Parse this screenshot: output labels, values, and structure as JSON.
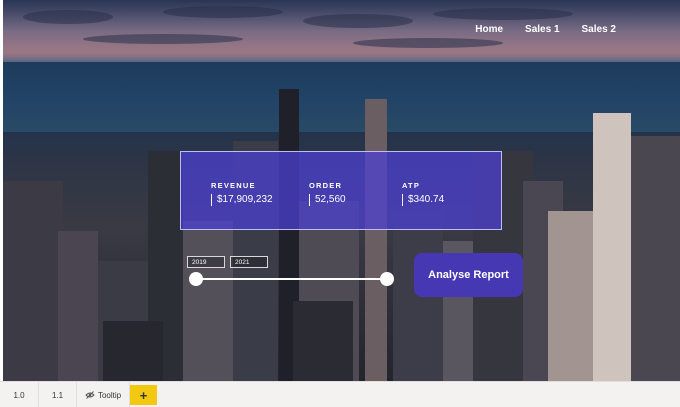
{
  "nav": {
    "home": "Home",
    "sales1": "Sales 1",
    "sales2": "Sales 2"
  },
  "kpis": [
    {
      "label": "REVENUE",
      "value": "$17,909,232"
    },
    {
      "label": "ORDER",
      "value": "52,560"
    },
    {
      "label": "ATP",
      "value": "$340.74"
    }
  ],
  "slider": {
    "start_year": "2019",
    "end_year": "2021",
    "start_fraction": 0.0,
    "end_fraction": 1.0
  },
  "button": {
    "analyse": "Analyse Report"
  },
  "tabs": [
    {
      "label": "1.0"
    },
    {
      "label": "1.1"
    },
    {
      "label": "Tooltip",
      "icon": "hidden-eye-icon"
    }
  ],
  "add_tab_label": "+",
  "colors": {
    "kpi_panel": "#4c40d6",
    "button": "#4637b3",
    "add_tab": "#f2c811"
  }
}
